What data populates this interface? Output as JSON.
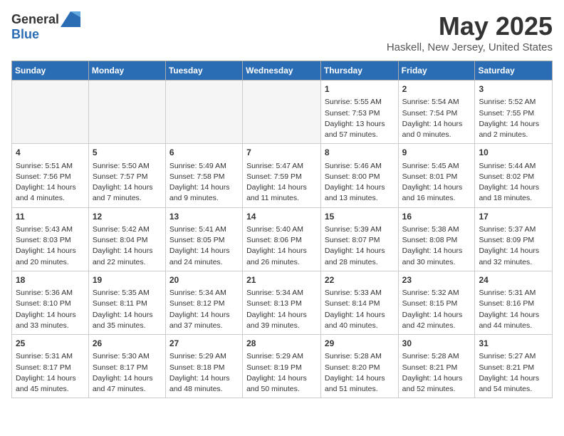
{
  "logo": {
    "text_general": "General",
    "text_blue": "Blue"
  },
  "title": {
    "month": "May 2025",
    "location": "Haskell, New Jersey, United States"
  },
  "headers": [
    "Sunday",
    "Monday",
    "Tuesday",
    "Wednesday",
    "Thursday",
    "Friday",
    "Saturday"
  ],
  "weeks": [
    [
      {
        "day": "",
        "empty": true
      },
      {
        "day": "",
        "empty": true
      },
      {
        "day": "",
        "empty": true
      },
      {
        "day": "",
        "empty": true
      },
      {
        "day": "1",
        "sunrise": "Sunrise: 5:55 AM",
        "sunset": "Sunset: 7:53 PM",
        "daylight": "Daylight: 13 hours and 57 minutes."
      },
      {
        "day": "2",
        "sunrise": "Sunrise: 5:54 AM",
        "sunset": "Sunset: 7:54 PM",
        "daylight": "Daylight: 14 hours and 0 minutes."
      },
      {
        "day": "3",
        "sunrise": "Sunrise: 5:52 AM",
        "sunset": "Sunset: 7:55 PM",
        "daylight": "Daylight: 14 hours and 2 minutes."
      }
    ],
    [
      {
        "day": "4",
        "sunrise": "Sunrise: 5:51 AM",
        "sunset": "Sunset: 7:56 PM",
        "daylight": "Daylight: 14 hours and 4 minutes."
      },
      {
        "day": "5",
        "sunrise": "Sunrise: 5:50 AM",
        "sunset": "Sunset: 7:57 PM",
        "daylight": "Daylight: 14 hours and 7 minutes."
      },
      {
        "day": "6",
        "sunrise": "Sunrise: 5:49 AM",
        "sunset": "Sunset: 7:58 PM",
        "daylight": "Daylight: 14 hours and 9 minutes."
      },
      {
        "day": "7",
        "sunrise": "Sunrise: 5:47 AM",
        "sunset": "Sunset: 7:59 PM",
        "daylight": "Daylight: 14 hours and 11 minutes."
      },
      {
        "day": "8",
        "sunrise": "Sunrise: 5:46 AM",
        "sunset": "Sunset: 8:00 PM",
        "daylight": "Daylight: 14 hours and 13 minutes."
      },
      {
        "day": "9",
        "sunrise": "Sunrise: 5:45 AM",
        "sunset": "Sunset: 8:01 PM",
        "daylight": "Daylight: 14 hours and 16 minutes."
      },
      {
        "day": "10",
        "sunrise": "Sunrise: 5:44 AM",
        "sunset": "Sunset: 8:02 PM",
        "daylight": "Daylight: 14 hours and 18 minutes."
      }
    ],
    [
      {
        "day": "11",
        "sunrise": "Sunrise: 5:43 AM",
        "sunset": "Sunset: 8:03 PM",
        "daylight": "Daylight: 14 hours and 20 minutes."
      },
      {
        "day": "12",
        "sunrise": "Sunrise: 5:42 AM",
        "sunset": "Sunset: 8:04 PM",
        "daylight": "Daylight: 14 hours and 22 minutes."
      },
      {
        "day": "13",
        "sunrise": "Sunrise: 5:41 AM",
        "sunset": "Sunset: 8:05 PM",
        "daylight": "Daylight: 14 hours and 24 minutes."
      },
      {
        "day": "14",
        "sunrise": "Sunrise: 5:40 AM",
        "sunset": "Sunset: 8:06 PM",
        "daylight": "Daylight: 14 hours and 26 minutes."
      },
      {
        "day": "15",
        "sunrise": "Sunrise: 5:39 AM",
        "sunset": "Sunset: 8:07 PM",
        "daylight": "Daylight: 14 hours and 28 minutes."
      },
      {
        "day": "16",
        "sunrise": "Sunrise: 5:38 AM",
        "sunset": "Sunset: 8:08 PM",
        "daylight": "Daylight: 14 hours and 30 minutes."
      },
      {
        "day": "17",
        "sunrise": "Sunrise: 5:37 AM",
        "sunset": "Sunset: 8:09 PM",
        "daylight": "Daylight: 14 hours and 32 minutes."
      }
    ],
    [
      {
        "day": "18",
        "sunrise": "Sunrise: 5:36 AM",
        "sunset": "Sunset: 8:10 PM",
        "daylight": "Daylight: 14 hours and 33 minutes."
      },
      {
        "day": "19",
        "sunrise": "Sunrise: 5:35 AM",
        "sunset": "Sunset: 8:11 PM",
        "daylight": "Daylight: 14 hours and 35 minutes."
      },
      {
        "day": "20",
        "sunrise": "Sunrise: 5:34 AM",
        "sunset": "Sunset: 8:12 PM",
        "daylight": "Daylight: 14 hours and 37 minutes."
      },
      {
        "day": "21",
        "sunrise": "Sunrise: 5:34 AM",
        "sunset": "Sunset: 8:13 PM",
        "daylight": "Daylight: 14 hours and 39 minutes."
      },
      {
        "day": "22",
        "sunrise": "Sunrise: 5:33 AM",
        "sunset": "Sunset: 8:14 PM",
        "daylight": "Daylight: 14 hours and 40 minutes."
      },
      {
        "day": "23",
        "sunrise": "Sunrise: 5:32 AM",
        "sunset": "Sunset: 8:15 PM",
        "daylight": "Daylight: 14 hours and 42 minutes."
      },
      {
        "day": "24",
        "sunrise": "Sunrise: 5:31 AM",
        "sunset": "Sunset: 8:16 PM",
        "daylight": "Daylight: 14 hours and 44 minutes."
      }
    ],
    [
      {
        "day": "25",
        "sunrise": "Sunrise: 5:31 AM",
        "sunset": "Sunset: 8:17 PM",
        "daylight": "Daylight: 14 hours and 45 minutes."
      },
      {
        "day": "26",
        "sunrise": "Sunrise: 5:30 AM",
        "sunset": "Sunset: 8:17 PM",
        "daylight": "Daylight: 14 hours and 47 minutes."
      },
      {
        "day": "27",
        "sunrise": "Sunrise: 5:29 AM",
        "sunset": "Sunset: 8:18 PM",
        "daylight": "Daylight: 14 hours and 48 minutes."
      },
      {
        "day": "28",
        "sunrise": "Sunrise: 5:29 AM",
        "sunset": "Sunset: 8:19 PM",
        "daylight": "Daylight: 14 hours and 50 minutes."
      },
      {
        "day": "29",
        "sunrise": "Sunrise: 5:28 AM",
        "sunset": "Sunset: 8:20 PM",
        "daylight": "Daylight: 14 hours and 51 minutes."
      },
      {
        "day": "30",
        "sunrise": "Sunrise: 5:28 AM",
        "sunset": "Sunset: 8:21 PM",
        "daylight": "Daylight: 14 hours and 52 minutes."
      },
      {
        "day": "31",
        "sunrise": "Sunrise: 5:27 AM",
        "sunset": "Sunset: 8:21 PM",
        "daylight": "Daylight: 14 hours and 54 minutes."
      }
    ]
  ]
}
